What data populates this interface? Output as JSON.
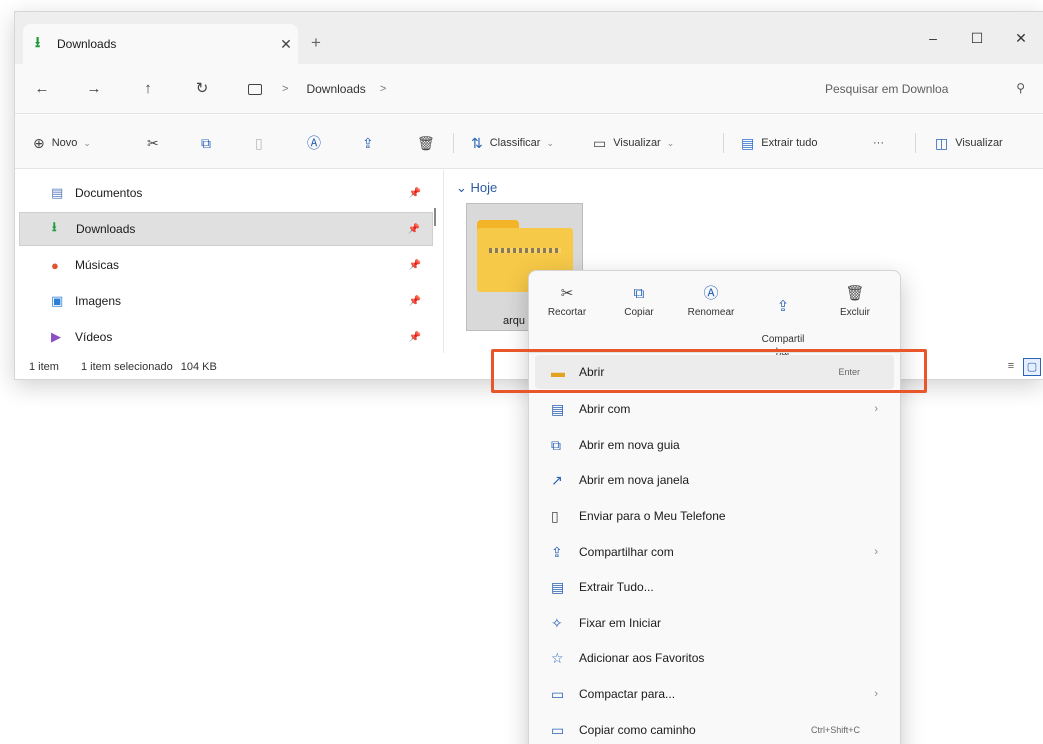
{
  "window": {
    "tab_title": "Downloads",
    "tab_close": "✕",
    "new_tab": "+",
    "controls": {
      "minimize": "–",
      "maximize": "☐",
      "close": "✕"
    }
  },
  "address": {
    "back": "←",
    "forward": "→",
    "up": "↑",
    "refresh": "↻",
    "crumb_sep": ">",
    "crumb": "Downloads",
    "crumb_sep2": ">",
    "search_placeholder": "Pesquisar em Downloa"
  },
  "commands": {
    "new_label": "Novo",
    "sort_label": "Classificar",
    "view_label": "Visualizar",
    "extract_label": "Extrair tudo",
    "more": "···",
    "details_label": "Visualizar"
  },
  "nav": {
    "items": [
      {
        "label": "Documentos",
        "icon": "document-icon"
      },
      {
        "label": "Downloads",
        "icon": "download-icon"
      },
      {
        "label": "Músicas",
        "icon": "music-icon"
      },
      {
        "label": "Imagens",
        "icon": "pictures-icon"
      },
      {
        "label": "Vídeos",
        "icon": "videos-icon"
      }
    ]
  },
  "content": {
    "group_header": "Hoje",
    "file_name": "arqu"
  },
  "status": {
    "count": "1 item",
    "selected": "1 item selecionado",
    "size": "104 KB"
  },
  "context_menu": {
    "quick": [
      {
        "label": "Recortar",
        "icon": "cut-icon"
      },
      {
        "label": "Copiar",
        "icon": "copy-icon"
      },
      {
        "label": "Renomear",
        "icon": "rename-icon"
      },
      {
        "label": "Compartil\nhar",
        "icon": "share-icon"
      },
      {
        "label": "Excluir",
        "icon": "delete-icon"
      }
    ],
    "items": [
      {
        "label": "Abrir",
        "shortcut": "Enter",
        "icon": "folder-open-icon"
      },
      {
        "label": "Abrir com",
        "icon": "open-with-icon",
        "submenu": true
      },
      {
        "label": "Abrir em nova guia",
        "icon": "new-tab-icon"
      },
      {
        "label": "Abrir em nova janela",
        "icon": "new-window-icon"
      },
      {
        "label": "Enviar para o Meu Telefone",
        "icon": "phone-icon"
      },
      {
        "label": "Compartilhar com",
        "icon": "share-with-icon",
        "submenu": true
      },
      {
        "label": "Extrair Tudo...",
        "icon": "extract-icon"
      },
      {
        "label": "Fixar em Iniciar",
        "icon": "pin-start-icon"
      },
      {
        "label": "Adicionar aos Favoritos",
        "icon": "star-icon"
      },
      {
        "label": "Compactar para...",
        "icon": "compress-icon",
        "submenu": true
      },
      {
        "label": "Copiar como caminho",
        "shortcut": "Ctrl+Shift+C",
        "icon": "copy-path-icon"
      }
    ]
  },
  "colors": {
    "accent": "#2b63b7",
    "highlight_box": "#e8562a",
    "folder": "#f7c948"
  }
}
